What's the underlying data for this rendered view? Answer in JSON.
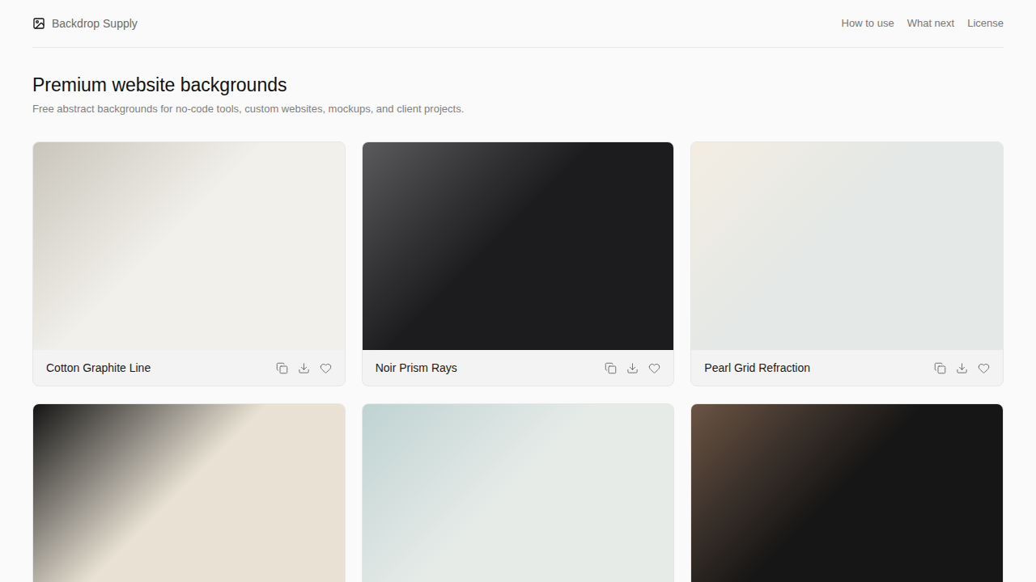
{
  "header": {
    "brand": "Backdrop Supply",
    "nav": [
      "How to use",
      "What next",
      "License"
    ]
  },
  "hero": {
    "title": "Premium website backgrounds",
    "subtitle": "Free abstract backgrounds for no-code tools, custom websites, mockups, and client projects."
  },
  "cards": [
    {
      "name": "Cotton Graphite Line",
      "color": "#f1f0ea",
      "accent": "#c9c5bb"
    },
    {
      "name": "Noir Prism Rays",
      "color": "#1c1c1e",
      "accent": "#5a5a5c"
    },
    {
      "name": "Pearl Grid Refraction",
      "color": "#e4e8e6",
      "accent": "#f3ede2"
    },
    {
      "name": "",
      "color": "#e9e2d4",
      "accent": "#141414"
    },
    {
      "name": "",
      "color": "#e6ebe8",
      "accent": "#bfd3d2"
    },
    {
      "name": "",
      "color": "#161616",
      "accent": "#6b5444"
    }
  ]
}
